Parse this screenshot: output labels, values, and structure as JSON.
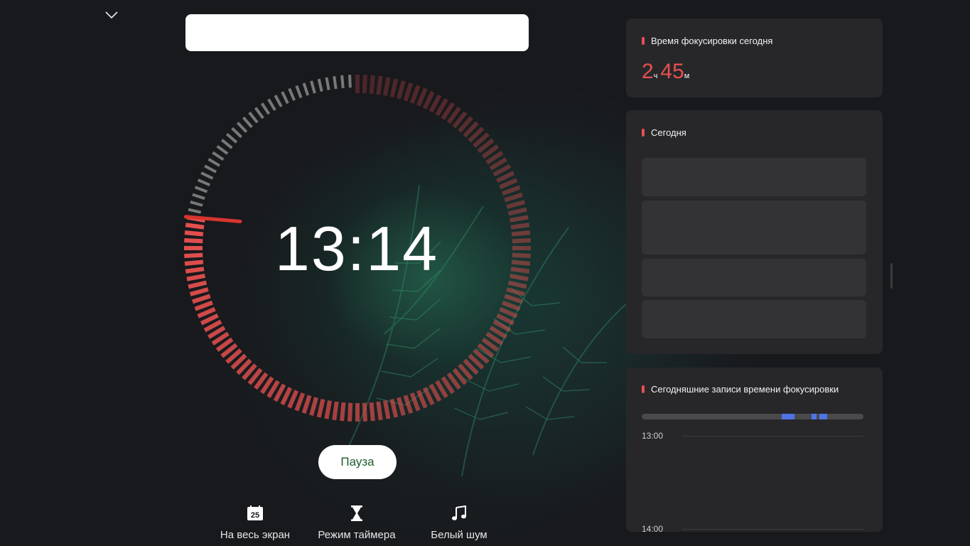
{
  "timer": {
    "display": "13:14",
    "progress_elapsed_fraction": 0.78,
    "track_color": "#e8504f",
    "tick_color": "#8a8a8a"
  },
  "task_input": {
    "value": "",
    "placeholder": ""
  },
  "pause_button": {
    "label": "Пауза"
  },
  "bottom_actions": [
    {
      "label": "На весь экран",
      "icon": "calendar-25-icon",
      "badge": "25"
    },
    {
      "label": "Режим таймера",
      "icon": "hourglass-icon"
    },
    {
      "label": "Белый шум",
      "icon": "music-note-icon"
    }
  ],
  "focus_today": {
    "title": "Время фокусировки сегодня",
    "hours": "2",
    "hours_unit": "ч",
    "minutes": "45",
    "minutes_unit": "м",
    "accent_color": "#e8504f"
  },
  "today_panel": {
    "title": "Сегодня",
    "slot_count": 4
  },
  "records_panel": {
    "title": "Сегодняшние записи времени фокусировки",
    "hours": [
      "13:00",
      "14:00"
    ],
    "segment_color": "#4e73e6",
    "segments": [
      {
        "start": 0.63,
        "end": 0.69
      },
      {
        "start": 0.765,
        "end": 0.79
      },
      {
        "start": 0.8,
        "end": 0.835
      }
    ]
  }
}
